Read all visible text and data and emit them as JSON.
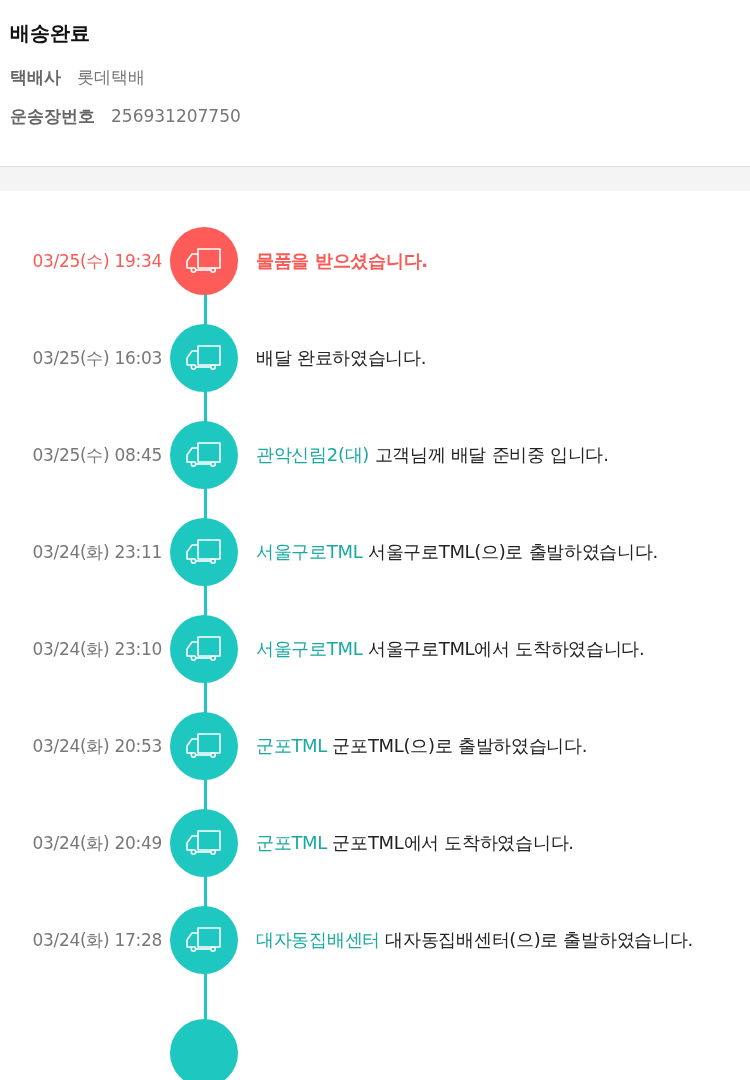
{
  "header": {
    "title": "배송완료",
    "fields": [
      {
        "label": "택배사",
        "value": "롯데택배"
      },
      {
        "label": "운송장번호",
        "value": "256931207750"
      }
    ]
  },
  "timeline": {
    "continues": true,
    "events": [
      {
        "time": "03/25(수) 19:34",
        "message": "물품을 받으셨습니다.",
        "current": true
      },
      {
        "time": "03/25(수) 16:03",
        "message": "배달 완료하였습니다.",
        "current": false
      },
      {
        "time": "03/25(수) 08:45",
        "location": "관악신림2(대)",
        "message": "고객님께 배달 준비중 입니다.",
        "current": false
      },
      {
        "time": "03/24(화) 23:11",
        "location": "서울구로TML",
        "message": "서울구로TML(으)로 출발하였습니다.",
        "current": false
      },
      {
        "time": "03/24(화) 23:10",
        "location": "서울구로TML",
        "message": "서울구로TML에서 도착하였습니다.",
        "current": false
      },
      {
        "time": "03/24(화) 20:53",
        "location": "군포TML",
        "message": "군포TML(으)로 출발하였습니다.",
        "current": false
      },
      {
        "time": "03/24(화) 20:49",
        "location": "군포TML",
        "message": "군포TML에서 도착하였습니다.",
        "current": false
      },
      {
        "time": "03/24(화) 17:28",
        "location": "대자동집배센터",
        "message": "대자동집배센터(으)로 출발하였습니다.",
        "current": false
      }
    ]
  }
}
